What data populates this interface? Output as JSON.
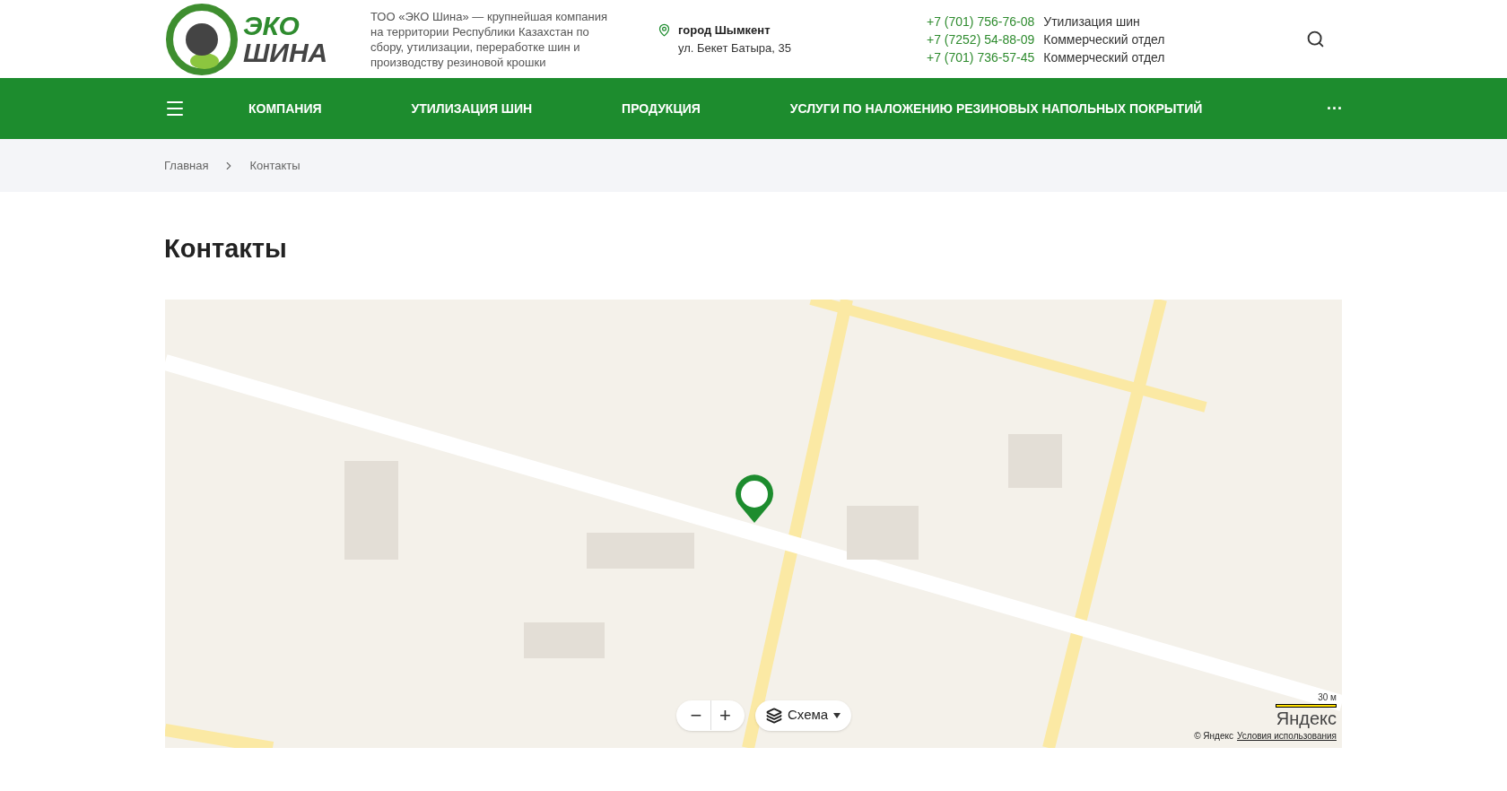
{
  "logo": {
    "line_1": "ЭКО",
    "line_2": "ШИНА"
  },
  "about": "ТОО «ЭКО Шина» — крупнейшая компания на территории Республики Казахстан по сбору, утилизации, переработке шин и производству резиновой крошки",
  "address": {
    "city": "город Шымкент",
    "street": "ул. Бекет Батыра, 35"
  },
  "phones": [
    {
      "number": "+7 (701) 756-76-08",
      "label": "Утилизация шин"
    },
    {
      "number": "+7 (7252) 54-88-09",
      "label": "Коммерческий отдел"
    },
    {
      "number": "+7 (701) 736-57-45",
      "label": "Коммерческий отдел"
    }
  ],
  "nav": {
    "items": [
      "КОМПАНИЯ",
      "УТИЛИЗАЦИЯ ШИН",
      "ПРОДУКЦИЯ",
      "УСЛУГИ ПО НАЛОЖЕНИЮ РЕЗИНОВЫХ НАПОЛЬНЫХ ПОКРЫТИЙ"
    ],
    "more": "···"
  },
  "breadcrumbs": [
    "Главная",
    "Контакты"
  ],
  "title": "Контакты",
  "map": {
    "zoom_out": "−",
    "zoom_in": "+",
    "layer_button": "Схема",
    "scale": "30 м",
    "brand": "Яндекс",
    "copyright": "© Яндекс",
    "terms": "Условия использования"
  }
}
